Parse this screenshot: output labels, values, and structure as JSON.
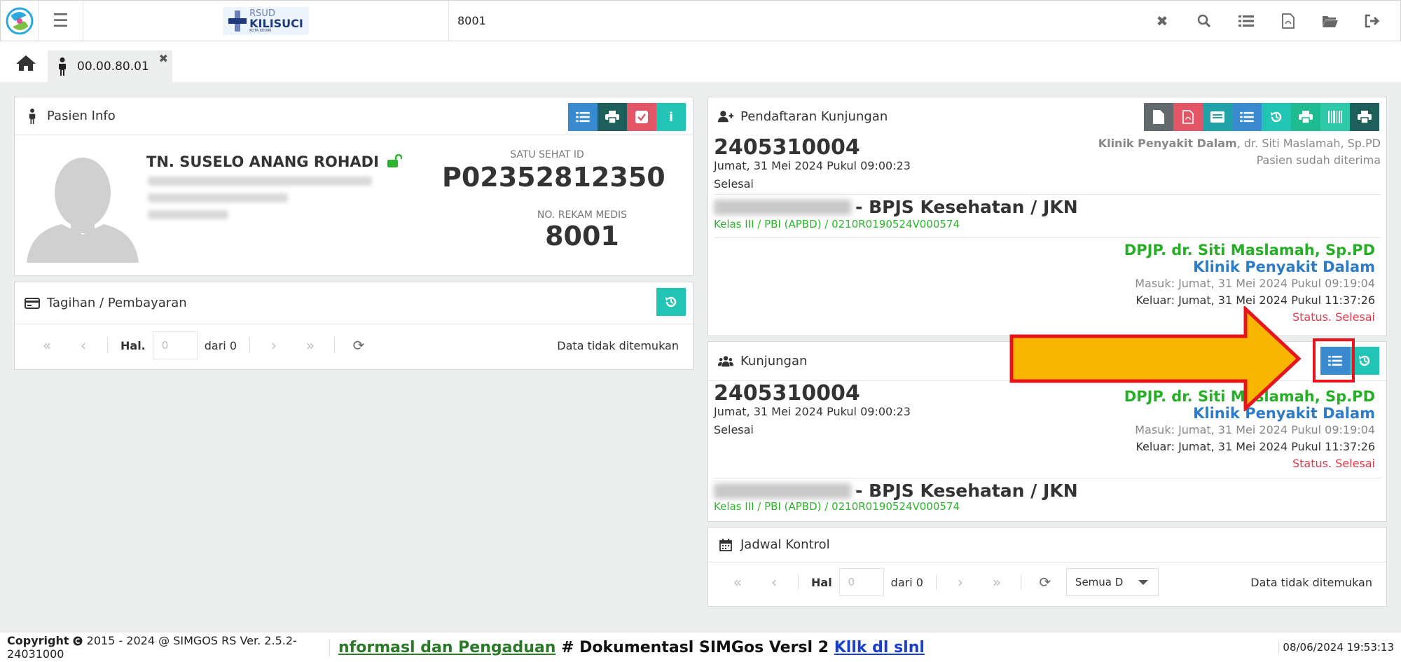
{
  "topbar": {
    "brand_rs": "RSUD",
    "brand_name": "KILISUCI",
    "brand_sub": "KOTA KEDIRI",
    "search_value": "8001",
    "icons": [
      "close-icon",
      "search-icon",
      "list-icon",
      "file-pdf-icon",
      "folder-open-icon",
      "sign-out-icon"
    ]
  },
  "tabs": {
    "home_icon": "home-icon",
    "patient_tab": "00.00.80.01"
  },
  "pasien_info": {
    "title": "Pasien Info",
    "name": "TN. SUSELO ANANG ROHADI",
    "satu_sehat_label": "SATU SEHAT ID",
    "satu_sehat_id": "P02352812350",
    "rm_label": "NO. REKAM MEDIS",
    "rm_value": "8001"
  },
  "tagihan": {
    "title": "Tagihan / Pembayaran",
    "pager": {
      "hal_label": "Hal.",
      "page_placeholder": "0",
      "of_label": "dari 0",
      "empty": "Data tidak ditemukan"
    }
  },
  "pendaftaran": {
    "title": "Pendaftaran Kunjungan",
    "no": "2405310004",
    "date": "Jumat, 31 Mei 2024 Pukul 09:00:23",
    "status": "Selesai",
    "clinic_bold": "Klinik Penyakit Dalam",
    "clinic_doctor": ", dr. Siti Maslamah, Sp.PD",
    "accepted": "Pasien sudah diterima",
    "insurance": "- BPJS Kesehatan / JKN",
    "kelas": "Kelas III / PBI (APBD) / 0210R0190524V000574",
    "dpjp": "DPJP. dr. Siti Maslamah, Sp.PD",
    "klinik": "Klinik Penyakit Dalam",
    "masuk": "Masuk: Jumat, 31 Mei 2024 Pukul 09:19:04",
    "keluar": "Keluar: Jumat, 31 Mei 2024 Pukul 11:37:26",
    "stat": "Status. Selesai"
  },
  "kunjungan": {
    "title": "Kunjungan",
    "no": "2405310004",
    "date": "Jumat, 31 Mei 2024 Pukul 09:00:23",
    "status": "Selesai",
    "dpjp": "DPJP. dr. Siti Maslamah, Sp.PD",
    "klinik": "Klinik Penyakit Dalam",
    "masuk": "Masuk: Jumat, 31 Mei 2024 Pukul 09:19:04",
    "keluar": "Keluar: Jumat, 31 Mei 2024 Pukul 11:37:26",
    "stat": "Status. Selesai",
    "insurance": "- BPJS Kesehatan / JKN",
    "kelas": "Kelas III / PBI (APBD) / 0210R0190524V000574"
  },
  "jadwal": {
    "title": "Jadwal Kontrol",
    "pager": {
      "hal_label": "Hal",
      "page_placeholder": "0",
      "of_label": "dari 0",
      "filter": "Semua D",
      "empty": "Data tidak ditemukan"
    }
  },
  "footer": {
    "copyright_bold": "Copyright",
    "copyright_rest": " 2015 - 2024 @ SIMGOS RS Ver. 2.5.2-24031000",
    "marquee_link1": "nformasl dan Pengaduan",
    "marquee_mid": " # Dokumentasl SIMGos Versl 2 ",
    "marquee_link2": "Kllk dl slnl",
    "datetime": "08/06/2024 19:53:13"
  },
  "colors": {
    "blue": "#3a8ad0",
    "dark_teal": "#1e5f5b",
    "red": "#e25566",
    "cyan": "#22c4b5",
    "green_text": "#27ae27",
    "blue_text": "#2e7bc6",
    "status_red": "#e03a4a",
    "arrow_yellow": "#f7b500",
    "highlight_red": "#e8141b"
  }
}
